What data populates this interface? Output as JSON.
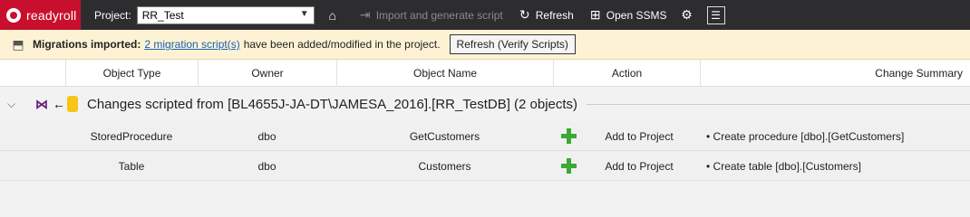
{
  "toolbar": {
    "logo_text": "readyroll",
    "project_label": "Project:",
    "project_value": "RR_Test",
    "import_label": "Import and generate script",
    "refresh_label": "Refresh",
    "open_ssms_label": "Open SSMS"
  },
  "notification": {
    "title": "Migrations imported:",
    "link_text": "2 migration script(s)",
    "message": "have been added/modified in the project.",
    "button_label": "Refresh (Verify Scripts)"
  },
  "table": {
    "columns": [
      "Object Type",
      "Owner",
      "Object Name",
      "Action",
      "Change Summary"
    ],
    "group_title": "Changes scripted from [BL4655J-JA-DT\\JAMESA_2016].[RR_TestDB] (2 objects)",
    "rows": [
      {
        "object_type": "StoredProcedure",
        "owner": "dbo",
        "object_name": "GetCustomers",
        "action": "Add to Project",
        "summary": "• Create procedure [dbo].[GetCustomers]"
      },
      {
        "object_type": "Table",
        "owner": "dbo",
        "object_name": "Customers",
        "action": "Add to Project",
        "summary": "• Create table [dbo].[Customers]"
      }
    ]
  },
  "icons": {
    "home": "home-icon",
    "import": "import-icon",
    "refresh": "refresh-icon",
    "ssms": "ssms-icon",
    "settings": "db-settings-icon",
    "panel": "panel-icon"
  },
  "colors": {
    "toolbar_bg": "#2d2d30",
    "logo_bg": "#c8102e",
    "notify_bg": "#fdf3d4",
    "link": "#1a5fb4",
    "plus": "#3aa935"
  }
}
